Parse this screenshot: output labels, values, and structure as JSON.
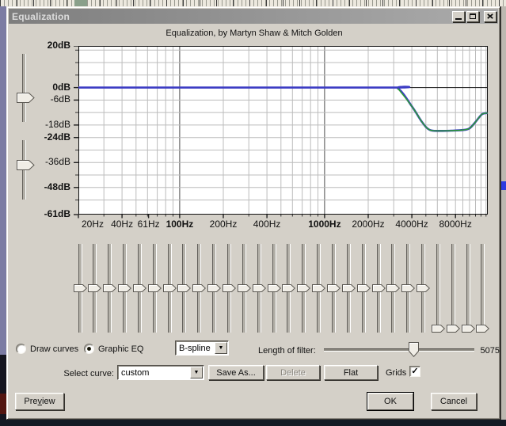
{
  "window": {
    "title": "Equalization"
  },
  "subtitle": "Equalization, by Martyn Shaw & Mitch Golden",
  "colors": {
    "dialog_bg": "#d4d0c8",
    "plot_bg": "#ffffff",
    "grid": "#bcbcbc",
    "grid_major": "#4a4a4a",
    "zero_line": "#151515",
    "curve_blue": "#3d3dc4",
    "curve_green": "#2da32d"
  },
  "graph": {
    "y_ticks": [
      {
        "label": "20dB",
        "db": 20,
        "bold": true
      },
      {
        "label": "0dB",
        "db": 0,
        "bold": true
      },
      {
        "label": "-6dB",
        "db": -6,
        "bold": false
      },
      {
        "label": "-18dB",
        "db": -18,
        "bold": false
      },
      {
        "label": "-24dB",
        "db": -24,
        "bold": true
      },
      {
        "label": "-36dB",
        "db": -36,
        "bold": false
      },
      {
        "label": "-48dB",
        "db": -48,
        "bold": true
      },
      {
        "label": "-61dB",
        "db": -61,
        "bold": true
      }
    ],
    "x_ticks": [
      {
        "label": "20Hz",
        "f": 20,
        "bold": false
      },
      {
        "label": "40Hz",
        "f": 40,
        "bold": false
      },
      {
        "label": "61Hz",
        "f": 61,
        "bold": false
      },
      {
        "label": "100Hz",
        "f": 100,
        "bold": true
      },
      {
        "label": "200Hz",
        "f": 200,
        "bold": false
      },
      {
        "label": "400Hz",
        "f": 400,
        "bold": false
      },
      {
        "label": "1000Hz",
        "f": 1000,
        "bold": true
      },
      {
        "label": "2000Hz",
        "f": 2000,
        "bold": false
      },
      {
        "label": "4000Hz",
        "f": 4000,
        "bold": false
      },
      {
        "label": "8000Hz",
        "f": 8000,
        "bold": false
      }
    ],
    "grid_db": [
      18,
      12,
      6,
      0,
      -6,
      -12,
      -18,
      -24,
      -30,
      -36,
      -42,
      -48,
      -54
    ],
    "grid_freqs": [
      30,
      40,
      50,
      60,
      70,
      80,
      90,
      100,
      200,
      300,
      400,
      500,
      600,
      700,
      800,
      900,
      1000,
      2000,
      3000,
      4000,
      5000,
      6000,
      7000,
      8000,
      9000,
      10000,
      11000,
      12000,
      13000
    ],
    "emphasis_freqs": [
      100,
      1000
    ],
    "curve_points": [
      [
        20,
        0
      ],
      [
        2500,
        0
      ],
      [
        3200,
        -0.4
      ],
      [
        4000,
        -9
      ],
      [
        4700,
        -16.5
      ],
      [
        5300,
        -20.3
      ],
      [
        6300,
        -20.8
      ],
      [
        7500,
        -20.7
      ],
      [
        9000,
        -20.4
      ],
      [
        10000,
        -19.6
      ],
      [
        11000,
        -16.5
      ],
      [
        12200,
        -12.8
      ],
      [
        13300,
        -12.2
      ]
    ]
  },
  "eq": {
    "range_db": 20,
    "bands": [
      0,
      0,
      0,
      0,
      0,
      0,
      0,
      0,
      0,
      0,
      0,
      0,
      0,
      0,
      0,
      0,
      0,
      0,
      0,
      0,
      0,
      0,
      0,
      0,
      -20,
      -20,
      -20,
      -20
    ]
  },
  "controls": {
    "mode": {
      "draw_label": "Draw curves",
      "graphic_label": "Graphic EQ",
      "selected": "Graphic EQ"
    },
    "interpolation": {
      "value": "B-spline"
    },
    "filter_length": {
      "label": "Length of filter:",
      "value": "5075"
    },
    "select_curve": {
      "label": "Select curve:",
      "value": "custom"
    },
    "save_as_label": "Save As...",
    "delete_label": "Delete",
    "flat_label": "Flat",
    "grids": {
      "label": "Grids",
      "checked": true
    }
  },
  "footer": {
    "preview": {
      "pre": "Pre",
      "accel": "v",
      "post": "iew"
    },
    "ok_label": "OK",
    "cancel_label": "Cancel"
  }
}
